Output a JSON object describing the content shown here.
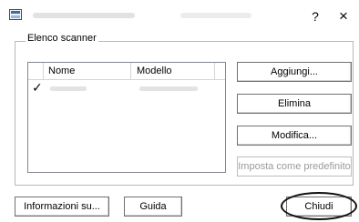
{
  "window": {
    "help_glyph": "?",
    "close_glyph": "×"
  },
  "scanner_group": {
    "label": "Elenco scanner",
    "columns": [
      "Nome",
      "Modello"
    ],
    "rows": [
      {
        "checked": true,
        "check_glyph": "✓"
      }
    ]
  },
  "side_buttons": {
    "add_label": "Aggiungi...",
    "delete_label": "Elimina",
    "modify_label": "Modifica...",
    "set_default_label": "Imposta come predefinito"
  },
  "bottom_buttons": {
    "info_label": "Informazioni su...",
    "guide_label": "Guida",
    "close_label": "Chiudi"
  }
}
